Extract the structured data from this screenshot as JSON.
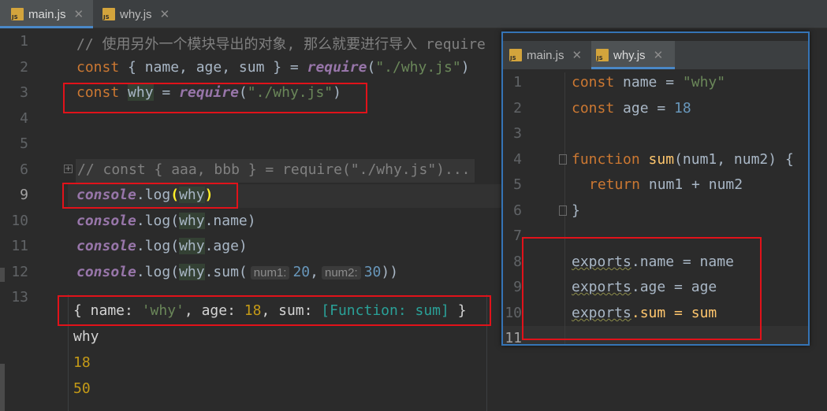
{
  "tabs": [
    {
      "label": "main.js",
      "close": "✕",
      "icon_text": "JS"
    },
    {
      "label": "why.js",
      "close": "✕",
      "icon_text": "JS"
    }
  ],
  "main_editor": {
    "line_numbers": [
      "1",
      "2",
      "3",
      "4",
      "5",
      "6",
      "9",
      "10",
      "11",
      "12",
      "13"
    ],
    "line1_comment": "// 使用另外一个模块导出的对象, 那么就要进行导入 require",
    "line2": {
      "kw": "const",
      "destructure": " { name, age, sum } = ",
      "req": "require",
      "open": "(",
      "str": "\"./why.js\"",
      "close": ")"
    },
    "line3": {
      "kw": "const",
      "var": "why",
      "eq": " = ",
      "req": "require",
      "open": "(",
      "str": "\"./why.js\"",
      "close": ")"
    },
    "line6_folded": "// const { aaa, bbb } = require(\"./why.js\")...",
    "line9": {
      "console": "console",
      "dot": ".",
      "fn": "log",
      "open": "(",
      "arg": "why",
      "close": ")"
    },
    "line10": {
      "console": "console",
      "dot": ".",
      "fn": "log",
      "open": "(",
      "arg": "why",
      "rest": ".name)"
    },
    "line11": {
      "console": "console",
      "dot": ".",
      "fn": "log",
      "open": "(",
      "arg": "why",
      "rest": ".age)"
    },
    "line12": {
      "console": "console",
      "dot": ".",
      "fn": "log",
      "open": "(",
      "arg": "why",
      "method": ".sum(",
      "hint1": "num1:",
      "val1": "20",
      "comma": ",",
      "hint2": "num2:",
      "val2": "30",
      "close": "))"
    }
  },
  "output": {
    "line1": {
      "open": "{ name: ",
      "name_val": "'why'",
      "mid1": ", age: ",
      "age_val": "18",
      "mid2": ", sum: ",
      "sum_val": "[Function: sum]",
      "close": " }"
    },
    "line2": "why",
    "line3": "18",
    "line4": "50"
  },
  "why_editor": {
    "line_numbers": [
      "1",
      "2",
      "3",
      "4",
      "5",
      "6",
      "7",
      "8",
      "9",
      "10",
      "11"
    ],
    "line1": {
      "kw": "const",
      "name": " name = ",
      "str": "\"why\""
    },
    "line2": {
      "kw": "const",
      "name": " age = ",
      "num": "18"
    },
    "line4": {
      "kw": "function",
      "fn": "sum",
      "params": "(num1, num2) {"
    },
    "line5": {
      "kw": "return",
      "expr": " num1 + num2"
    },
    "line6": "}",
    "line8": {
      "obj": "exports",
      "prop": ".name",
      "rest": " = name"
    },
    "line9": {
      "obj": "exports",
      "prop": ".age",
      "rest": " = age"
    },
    "line10": {
      "obj": "exports",
      "prop": ".sum",
      "rest": " = sum"
    }
  },
  "colors": {
    "accent": "#3574b6",
    "annotation_box": "#e1121a",
    "background": "#2b2b2b"
  }
}
